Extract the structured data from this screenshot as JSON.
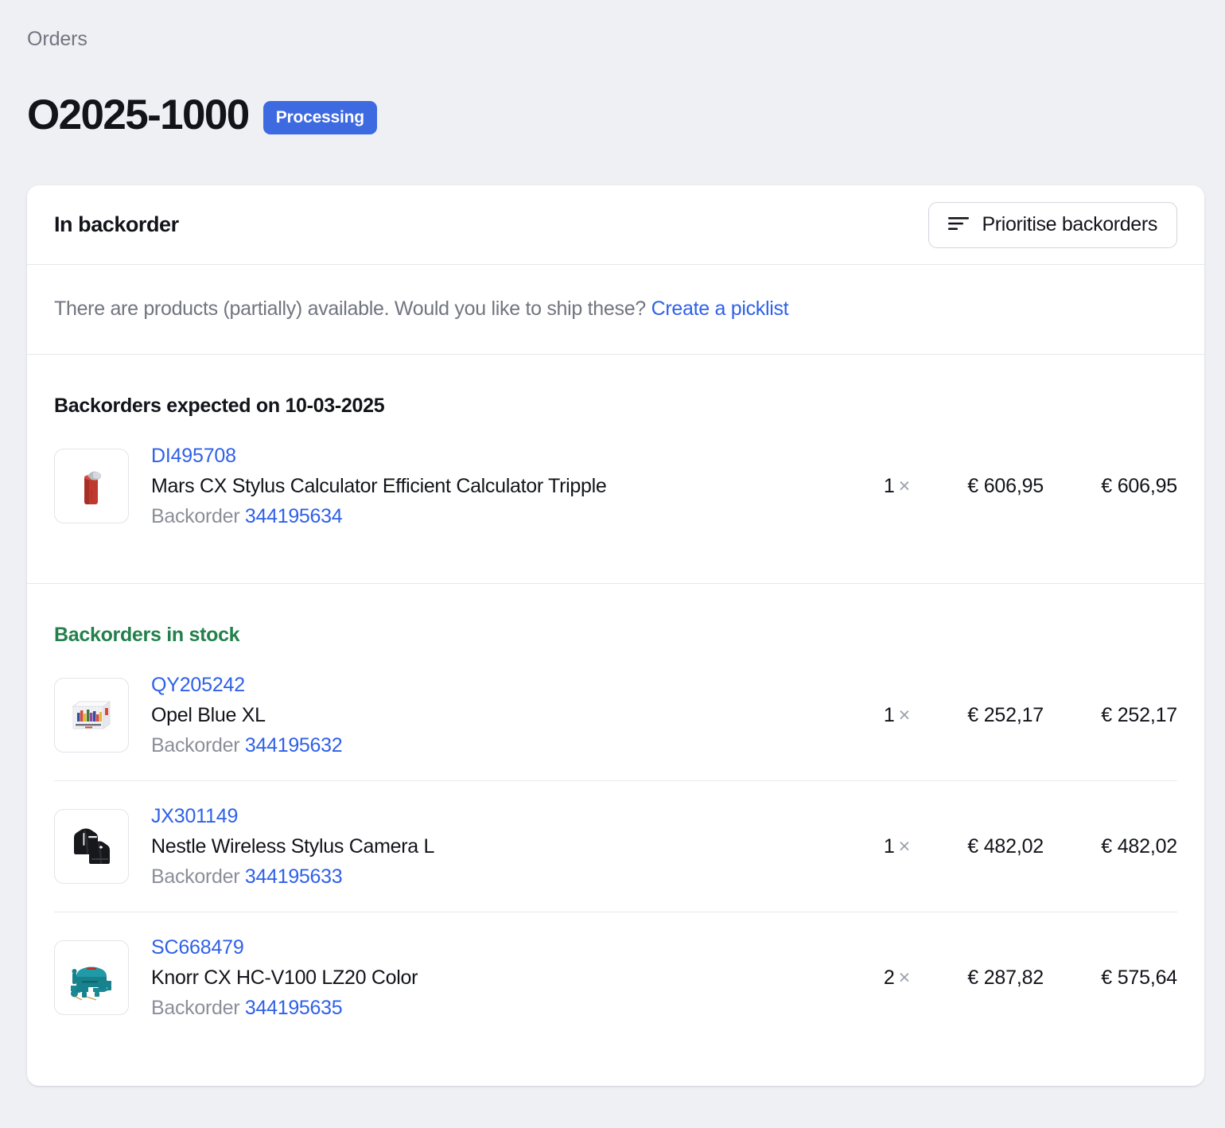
{
  "breadcrumb": {
    "label": "Orders"
  },
  "header": {
    "order_id": "O2025-1000",
    "status": "Processing",
    "status_color": "#3d69e1"
  },
  "card": {
    "title": "In backorder",
    "prioritise_button": {
      "label": "Prioritise backorders",
      "icon": "sort-descending-icon"
    },
    "notice": {
      "text": "There are products (partially) available. Would you like to ship these?",
      "link_label": "Create a picklist",
      "link_color": "#2f61e8"
    },
    "groups": [
      {
        "heading": "Backorders expected on 10-03-2025",
        "heading_color": "#12141a",
        "items": [
          {
            "sku": "DI495708",
            "name": "Mars CX Stylus Calculator Efficient Calculator Tripple",
            "backorder_label": "Backorder",
            "backorder_id": "344195634",
            "qty": "1",
            "times": "×",
            "price": "€ 606,95",
            "total": "€ 606,95",
            "thumb": "red-bin"
          }
        ]
      },
      {
        "heading": "Backorders in stock",
        "heading_color": "#23804c",
        "items": [
          {
            "sku": "QY205242",
            "name": "Opel Blue XL",
            "backorder_label": "Backorder",
            "backorder_id": "344195632",
            "qty": "1",
            "times": "×",
            "price": "€ 252,17",
            "total": "€ 252,17",
            "thumb": "white-boxset"
          },
          {
            "sku": "JX301149",
            "name": "Nestle Wireless Stylus Camera L",
            "backorder_label": "Backorder",
            "backorder_id": "344195633",
            "qty": "1",
            "times": "×",
            "price": "€ 482,02",
            "total": "€ 482,02",
            "thumb": "black-jackets"
          },
          {
            "sku": "SC668479",
            "name": "Knorr CX HC-V100 LZ20 Color",
            "backorder_label": "Backorder",
            "backorder_id": "344195635",
            "qty": "2",
            "times": "×",
            "price": "€ 287,82",
            "total": "€ 575,64",
            "thumb": "teal-toolset"
          }
        ]
      }
    ]
  }
}
